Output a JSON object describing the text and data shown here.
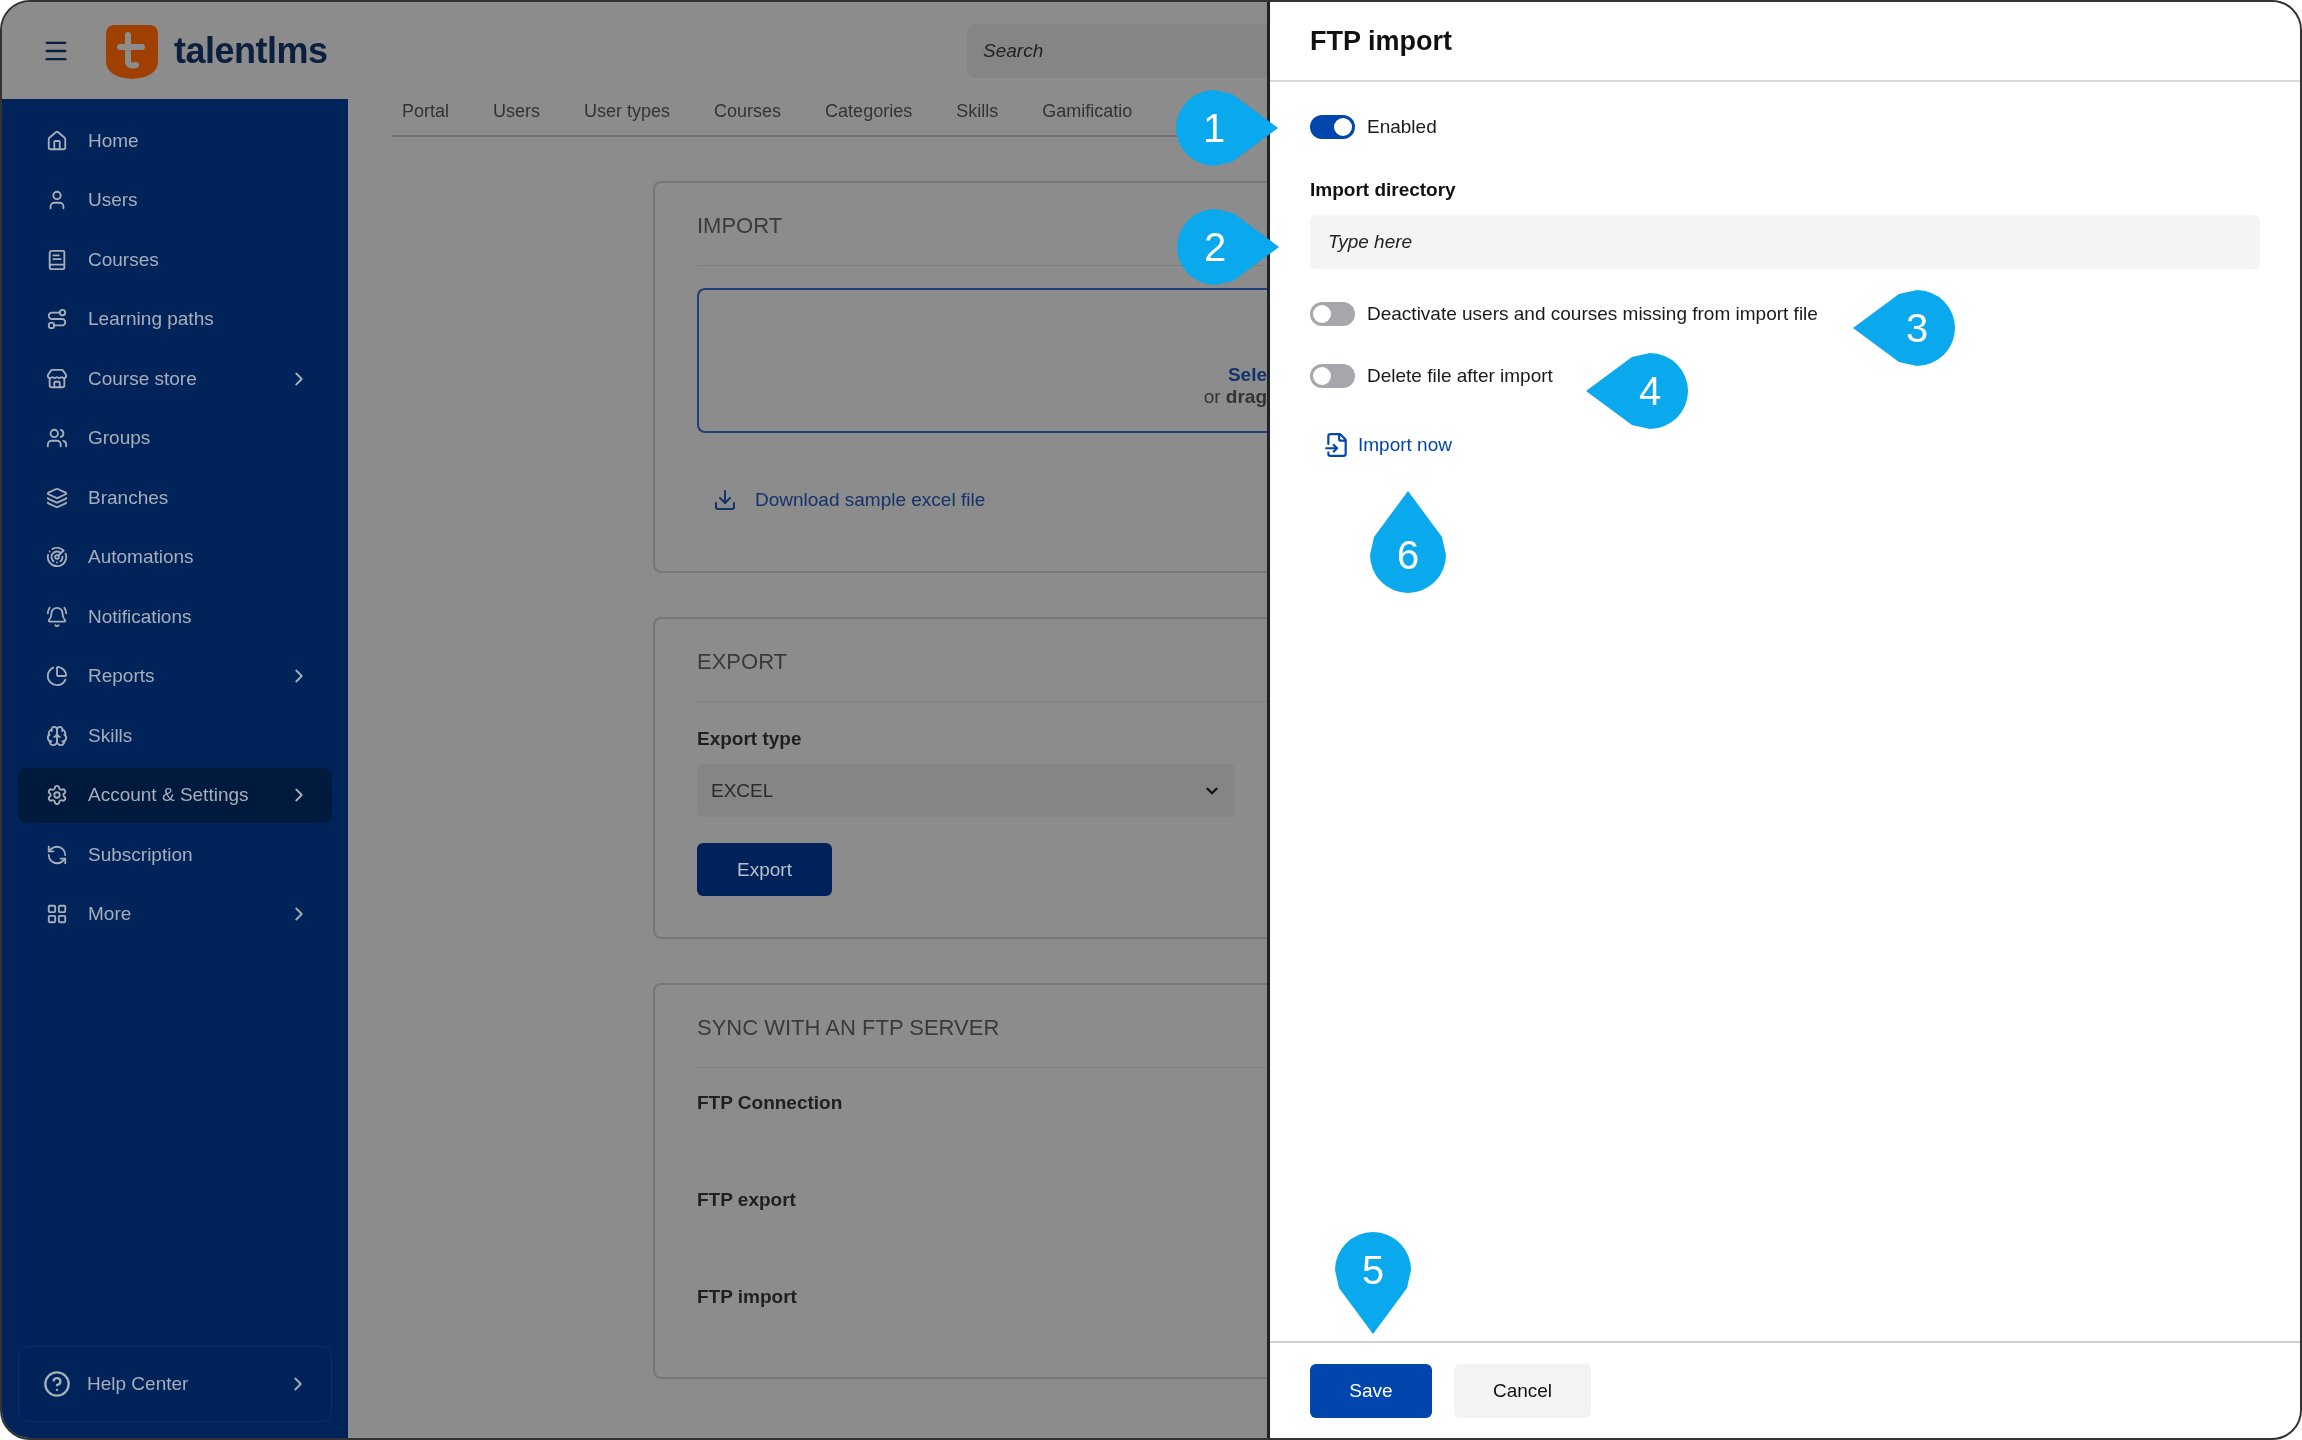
{
  "header": {
    "logo": "talentlms",
    "search": {
      "placeholder": "Search"
    }
  },
  "sidebar": {
    "items": [
      {
        "label": "Home",
        "selected": false,
        "has_submenu": false
      },
      {
        "label": "Users",
        "selected": false,
        "has_submenu": false
      },
      {
        "label": "Courses",
        "selected": false,
        "has_submenu": false
      },
      {
        "label": "Learning paths",
        "selected": false,
        "has_submenu": false
      },
      {
        "label": "Course store",
        "selected": false,
        "has_submenu": true
      },
      {
        "label": "Groups",
        "selected": false,
        "has_submenu": false
      },
      {
        "label": "Branches",
        "selected": false,
        "has_submenu": false
      },
      {
        "label": "Automations",
        "selected": false,
        "has_submenu": false
      },
      {
        "label": "Notifications",
        "selected": false,
        "has_submenu": false
      },
      {
        "label": "Reports",
        "selected": false,
        "has_submenu": true
      },
      {
        "label": "Skills",
        "selected": false,
        "has_submenu": false
      },
      {
        "label": "Account & Settings",
        "selected": true,
        "has_submenu": true
      },
      {
        "label": "Subscription",
        "selected": false,
        "has_submenu": false
      },
      {
        "label": "More",
        "selected": false,
        "has_submenu": true
      }
    ],
    "help": {
      "label": "Help Center"
    }
  },
  "tabs": [
    {
      "label": "Portal",
      "selected": false
    },
    {
      "label": "Users",
      "selected": false
    },
    {
      "label": "User types",
      "selected": false
    },
    {
      "label": "Courses",
      "selected": false
    },
    {
      "label": "Categories",
      "selected": false
    },
    {
      "label": "Skills",
      "selected": false
    },
    {
      "label": "Gamificatio",
      "selected": false
    }
  ],
  "import_card": {
    "title": "IMPORT",
    "drop_link": "Sele",
    "drop_hint": "or **drag**",
    "download_link": "Download sample excel file"
  },
  "export_card": {
    "title": "EXPORT",
    "type_label": "Export type",
    "type_value": "EXCEL",
    "button": "Export"
  },
  "sync_card": {
    "title": "SYNC WITH AN FTP SERVER",
    "rows": [
      "FTP Connection",
      "FTP export",
      "FTP import"
    ]
  },
  "drawer": {
    "title": "FTP import",
    "enabled": {
      "label": "Enabled",
      "on": true
    },
    "directory_label": "Import directory",
    "directory": {
      "placeholder": "Type here"
    },
    "options": [
      {
        "label": "Deactivate users and courses missing from import file",
        "on": false
      },
      {
        "label": "Delete file after import",
        "on": false
      }
    ],
    "import_now": "Import now",
    "save": "Save",
    "cancel": "Cancel"
  },
  "callouts": [
    {
      "label": "1"
    },
    {
      "label": "2"
    },
    {
      "label": "3"
    },
    {
      "label": "4"
    },
    {
      "label": "5"
    },
    {
      "label": "6"
    }
  ]
}
